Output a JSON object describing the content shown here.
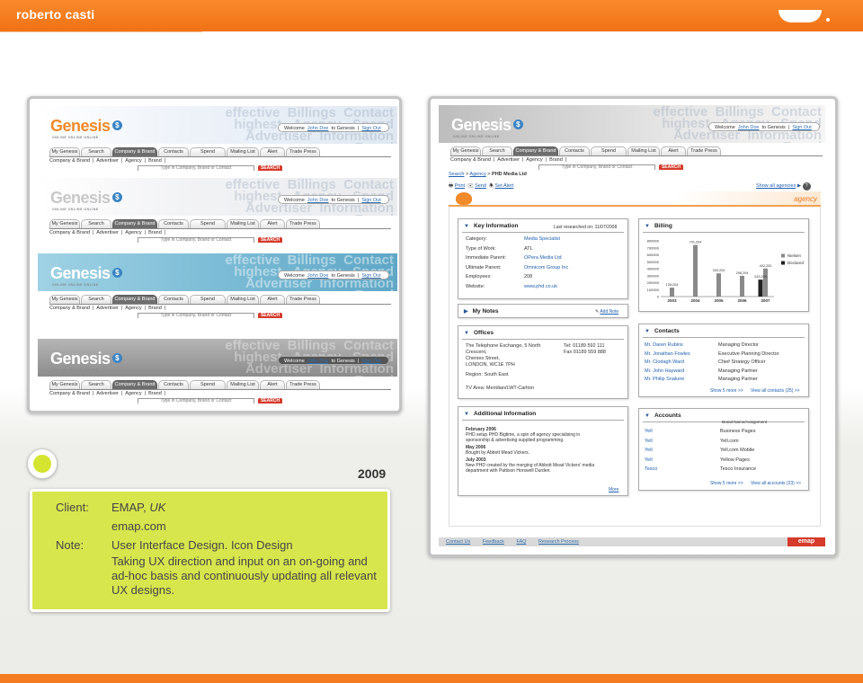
{
  "site": {
    "brand": "roberto casti"
  },
  "genesis": {
    "logo": "Genesis",
    "logo_sub": "ONLINE ONLINE ONLINE",
    "logo_icon": "$",
    "watermark": "effective  Billings  Contact\nhighest   Agency   Spend\nAdvertiser  Information\nBrand",
    "welcome": {
      "prefix": "Welcome",
      "user": "John Doe",
      "to": "to Genesis",
      "signout": "Sign Out"
    },
    "tabs": [
      "My Genesis",
      "Search",
      "Company & Brand",
      "Contacts",
      "Spend",
      "Mailing List",
      "Alert",
      "Trade Press"
    ],
    "active_tab": "Company & Brand",
    "subnav": [
      "Company & Brand",
      "Advertiser",
      "Agency",
      "Brand"
    ],
    "search_placeholder": "Type in Company, Brand or Contact",
    "search_button": "SEARCH",
    "banner_colors": [
      "#e7eef6",
      "#f2f4f7",
      "#7cbcd6",
      "#9a9a9a"
    ]
  },
  "detail": {
    "breadcrumb": {
      "search": "Search",
      "agency": "Agency",
      "current": "PHD Media Ltd"
    },
    "toolbar": {
      "print": "Print",
      "send": "Send",
      "set_alert": "Set Alert",
      "show_all": "Show all agencies"
    },
    "agency_label": "agency",
    "key_info": {
      "title": "Key Information",
      "last_researched": "Last researched on: 11/07/2008",
      "rows": [
        {
          "label": "Category:",
          "value": "Media Specialist",
          "link": true
        },
        {
          "label": "Type of Work:",
          "value": "ATL",
          "link": false
        },
        {
          "label": "Immediate Parent:",
          "value": "OPera Media Ltd",
          "link": true
        },
        {
          "label": "Ultimate Parent:",
          "value": "Omnicom Group Inc",
          "link": true
        },
        {
          "label": "Employees:",
          "value": "208",
          "link": false
        },
        {
          "label": "Website:",
          "value": "www.phd.co.uk",
          "link": true
        }
      ]
    },
    "notes": {
      "title": "My Notes",
      "add": "Add Note"
    },
    "offices": {
      "title": "Offices",
      "address": [
        "The Telephone Exchange, 5 North",
        "Crescent,",
        "Chenies Street,",
        "LONDON, WC1E 7PH"
      ],
      "tel": "Tel: 01189 592 111",
      "fax": "Fax 01189 559 888",
      "region": "Region: South East",
      "tv_area": "TV Area: Meridian/LWT-Carlton"
    },
    "additional": {
      "title": "Additional Information",
      "entries": [
        {
          "date": "February 2006",
          "text": [
            "PHD setup PHD Bigtime, a spin off agency specialising in",
            "sponsorship & advertising supplied programming."
          ]
        },
        {
          "date": "May 2006",
          "text": [
            "Bought by Abbott Mead Vickers."
          ]
        },
        {
          "date": "July 2003",
          "text": [
            "New PHD created by the merging of Abbott Mead Vickers' media",
            "department with Pattison Horswell Durden."
          ]
        }
      ],
      "more": "More"
    },
    "billing": {
      "title": "Billing"
    },
    "contacts": {
      "title": "Contacts",
      "rows": [
        {
          "name": "Mr. Daren Rubins",
          "role": "Managing Director"
        },
        {
          "name": "Mr. Jonathan Fowles",
          "role": "Executive Planning Director"
        },
        {
          "name": "Mr. Clodagh Ward",
          "role": "Chief Strategy Officer"
        },
        {
          "name": "Mr. John Hayward",
          "role": "Managing Partner"
        },
        {
          "name": "Mr. Philip Snalune",
          "role": "Managing Partner"
        }
      ],
      "show_more": "Show 5 more >>",
      "view_all": "View all contacts (25) >>"
    },
    "accounts": {
      "title": "Accounts",
      "header": "Brand Name/Assignment",
      "rows": [
        {
          "name": "Yell",
          "assign": "Business Pages"
        },
        {
          "name": "Yell",
          "assign": "Yell.com"
        },
        {
          "name": "Yell",
          "assign": "Yell.com Mobile"
        },
        {
          "name": "Yell",
          "assign": "Yellow Pages"
        },
        {
          "name": "Tesco",
          "assign": "Tesco Insurance"
        }
      ],
      "show_more": "Show 5 more >>",
      "view_all": "View all accounts (23) >>"
    },
    "footer": {
      "links": [
        "Contact Us",
        "Feedback",
        "FAQ",
        "Research Process"
      ],
      "brand": "emap"
    }
  },
  "chart_data": {
    "type": "bar",
    "categories": [
      "2003",
      "2004",
      "2005",
      "2006",
      "2007"
    ],
    "series": [
      {
        "name": "Nielsen",
        "values": [
          128204,
          741204,
          333204,
          298204,
          402200
        ]
      },
      {
        "name": "Declared",
        "values": [
          0,
          0,
          0,
          0,
          243204
        ]
      }
    ],
    "data_labels": [
      "128,204",
      "741,204",
      "333,204",
      "298,204",
      "402,200",
      "243,204"
    ],
    "ylim": [
      0,
      800000
    ],
    "yticks": [
      "800000",
      "700000",
      "600000",
      "500000",
      "400000",
      "300000",
      "200000",
      "100000",
      "0"
    ],
    "colors": {
      "Nielsen": "#8a8a8a",
      "Declared": "#222222"
    },
    "legend_position": "right"
  },
  "card": {
    "year": "2009",
    "client_label": "Client:",
    "client_value": "EMAP,",
    "client_value_italic": "UK",
    "site": "emap.com",
    "note_label": "Note:",
    "note_value": "User Interface Design. Icon Design",
    "paragraph": "Taking UX direction and input on an on-going and ad-hoc basis and continuously updating all relevant UX designs."
  }
}
